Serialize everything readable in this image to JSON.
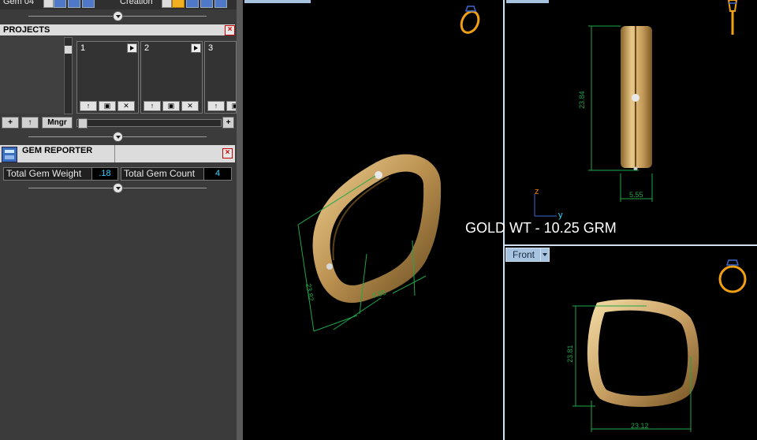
{
  "top_strip": {
    "left_label": "Gem 04",
    "right_label": "Creation"
  },
  "projects": {
    "title": "PROJECTS",
    "close_label": "×",
    "slots": [
      {
        "number": "1"
      },
      {
        "number": "2"
      },
      {
        "number": "3"
      }
    ],
    "buttons": {
      "add": "+",
      "up": "↑",
      "manager": "Mngr",
      "zoom_plus": "+"
    },
    "slot_buttons": {
      "up": "↑",
      "save": "▣",
      "delete": "✕"
    }
  },
  "gem_reporter": {
    "title": "GEM REPORTER",
    "close_label": "×",
    "total_weight_label": "Total Gem Weight",
    "total_weight_value": ".18",
    "total_count_label": "Total Gem Count",
    "total_count_value": "4"
  },
  "viewports": {
    "front_tab": "Front",
    "side_axes": {
      "z": "z",
      "y": "y"
    },
    "side_dims": {
      "height": "23.84",
      "width": "5.55"
    },
    "persp_dims": {
      "a": "23.82",
      "b": "5.55"
    },
    "front_dims": {
      "height": "23.81",
      "width": "23.12"
    }
  },
  "annotation": {
    "gold_weight": "GOLD WT - 10.25 GRM"
  },
  "colors": {
    "accent_blue": "#a6c4e0",
    "gem_value": "#2fd6ff",
    "dimension_green": "#1fa64a",
    "gold": "#c9a064"
  }
}
